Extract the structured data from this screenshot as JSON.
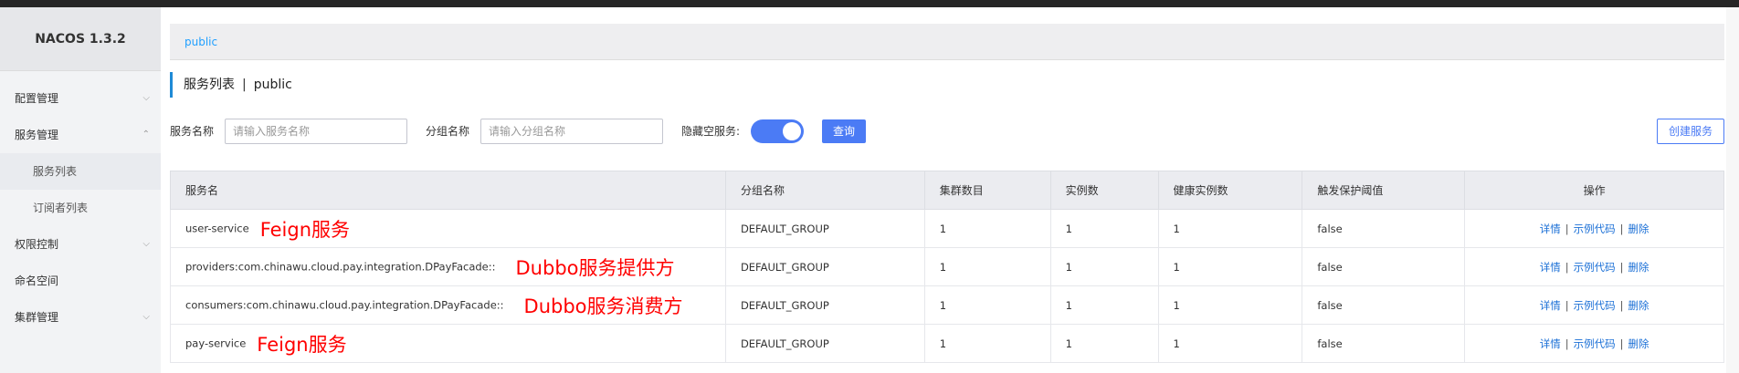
{
  "app": {
    "title": "NACOS 1.3.2"
  },
  "sidebar": {
    "items": [
      {
        "label": "配置管理",
        "chevron": "⌵"
      },
      {
        "label": "服务管理",
        "chevron": "⌃"
      },
      {
        "label": "服务列表"
      },
      {
        "label": "订阅者列表"
      },
      {
        "label": "权限控制",
        "chevron": "⌵"
      },
      {
        "label": "命名空间"
      },
      {
        "label": "集群管理",
        "chevron": "⌵"
      }
    ]
  },
  "breadcrumb": {
    "namespace": "public"
  },
  "page": {
    "title": "服务列表",
    "separator": "|",
    "namespace": "public"
  },
  "filters": {
    "service_name_label": "服务名称",
    "service_name_placeholder": "请输入服务名称",
    "group_name_label": "分组名称",
    "group_name_placeholder": "请输入分组名称",
    "hide_empty_label": "隐藏空服务:",
    "hide_empty_on": true,
    "query_button": "查询",
    "create_button": "创建服务"
  },
  "table": {
    "headers": [
      "服务名",
      "分组名称",
      "集群数目",
      "实例数",
      "健康实例数",
      "触发保护阈值",
      "操作"
    ],
    "rows": [
      {
        "service": "user-service",
        "annotation": "Feign服务",
        "group": "DEFAULT_GROUP",
        "clusters": "1",
        "instances": "1",
        "healthy": "1",
        "threshold": "false"
      },
      {
        "service": "providers:com.chinawu.cloud.pay.integration.DPayFacade::",
        "annotation": "Dubbo服务提供方",
        "group": "DEFAULT_GROUP",
        "clusters": "1",
        "instances": "1",
        "healthy": "1",
        "threshold": "false"
      },
      {
        "service": "consumers:com.chinawu.cloud.pay.integration.DPayFacade::",
        "annotation": "Dubbo服务消费方",
        "group": "DEFAULT_GROUP",
        "clusters": "1",
        "instances": "1",
        "healthy": "1",
        "threshold": "false"
      },
      {
        "service": "pay-service",
        "annotation": "Feign服务",
        "group": "DEFAULT_GROUP",
        "clusters": "1",
        "instances": "1",
        "healthy": "1",
        "threshold": "false"
      }
    ],
    "ops": {
      "detail": "详情",
      "sample_code": "示例代码",
      "delete": "删除",
      "sep": "|"
    }
  },
  "colors": {
    "accent": "#4b7bf5",
    "link": "#1a6fd6",
    "annotation": "#ff0000",
    "crumb": "#20a0ff"
  }
}
